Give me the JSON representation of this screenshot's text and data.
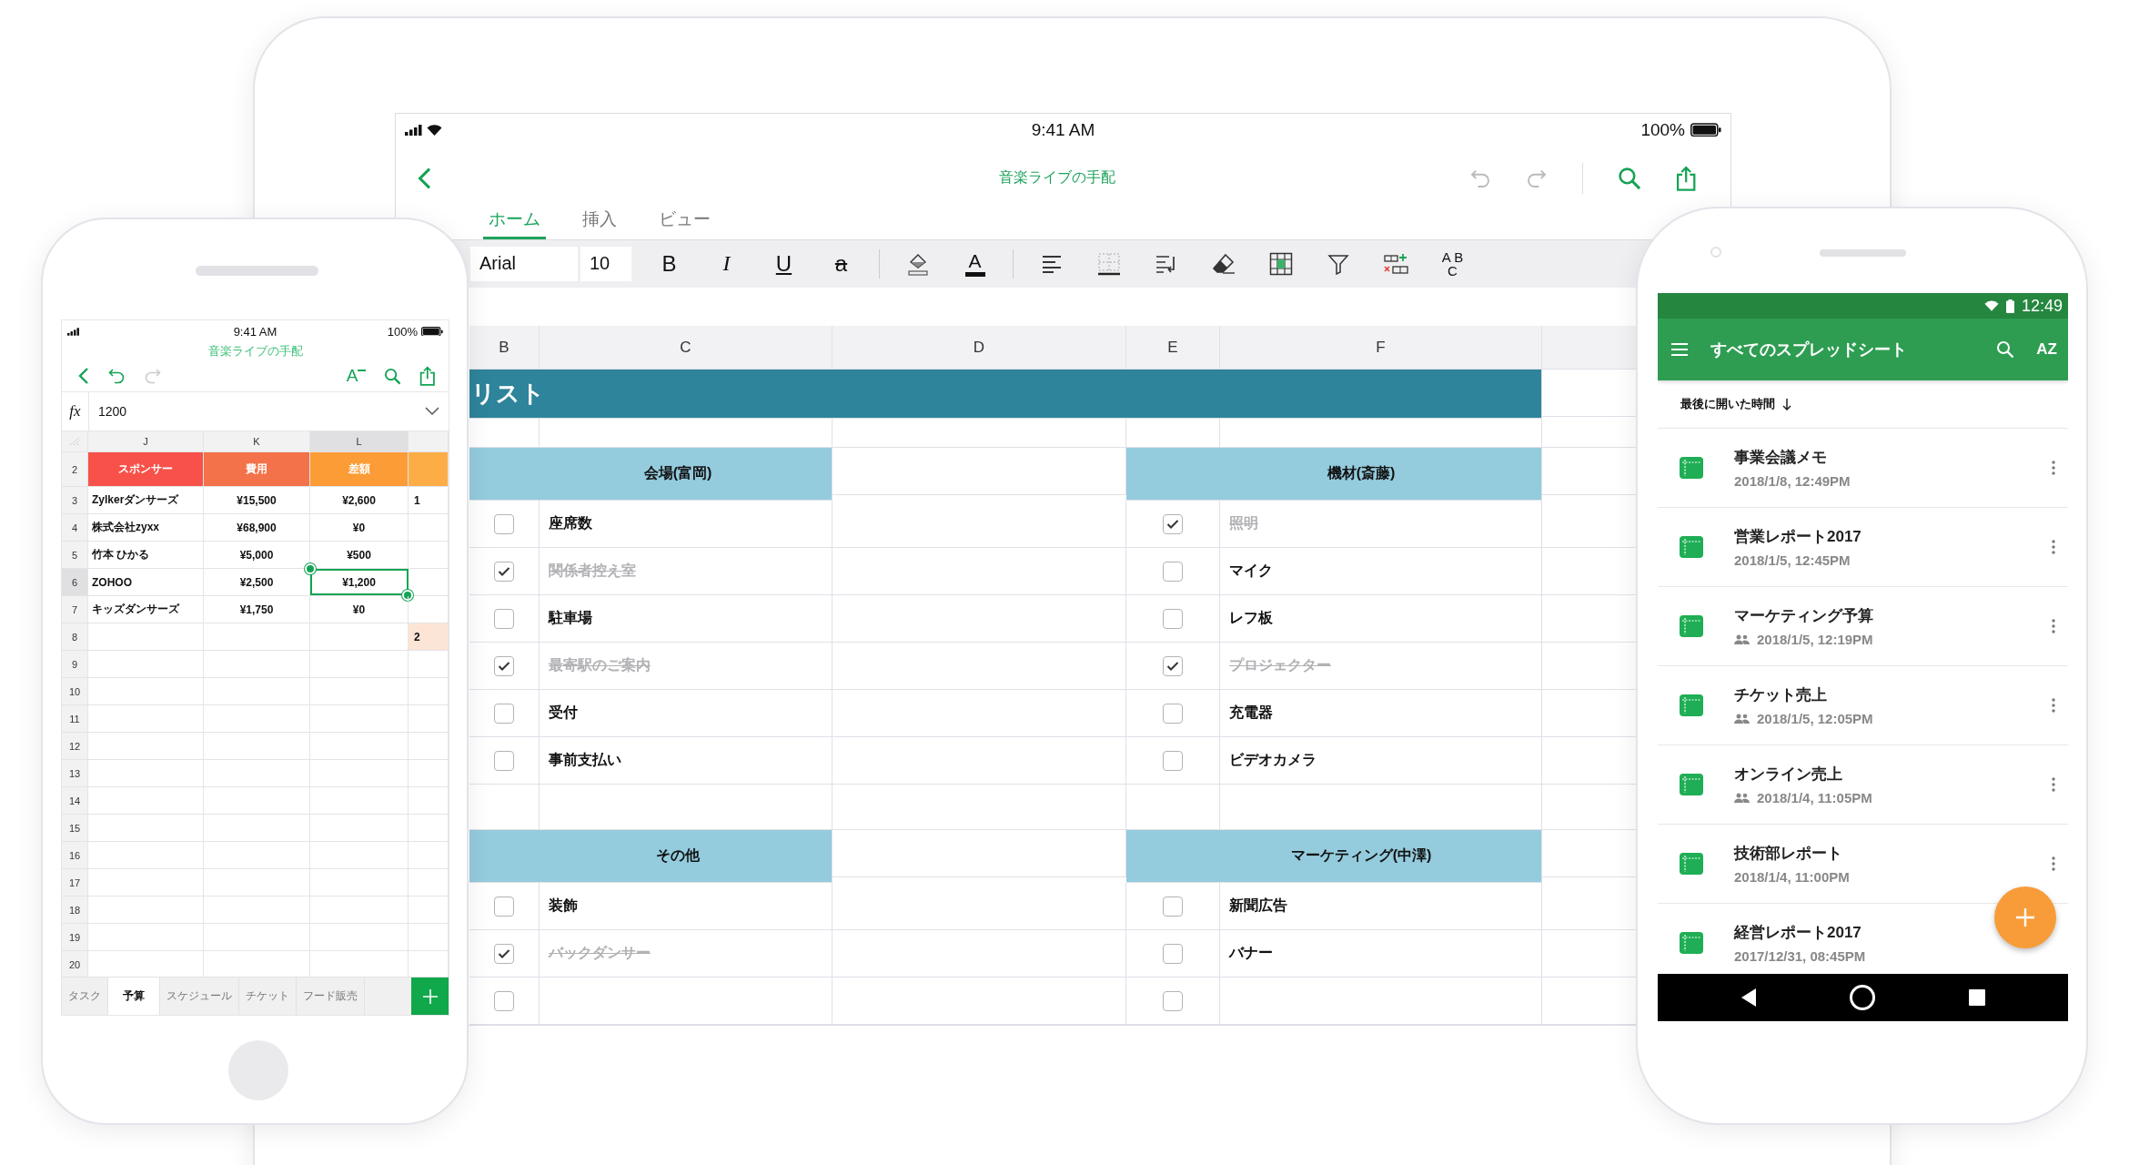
{
  "tablet": {
    "status_bar": {
      "time": "9:41 AM",
      "battery": "100%"
    },
    "title": "音楽ライブの手配",
    "tabs": [
      {
        "label": "ホーム",
        "selected": true
      },
      {
        "label": "挿入",
        "selected": false
      },
      {
        "label": "ビュー",
        "selected": false
      }
    ],
    "toolbar": {
      "font": "Arial",
      "size": "10",
      "bold": "B",
      "italic": "I",
      "underline": "U",
      "strikethrough": "a",
      "font_color": "A",
      "spelling": [
        "A B",
        "C"
      ]
    },
    "sheet": {
      "columns": [
        "B",
        "C",
        "D",
        "E",
        "F"
      ],
      "title": "リスト",
      "blocks": [
        {
          "left_header": "会場(富岡)",
          "right_header": "機材(斎藤)",
          "rows": [
            {
              "left": {
                "label": "座席数",
                "checked": false
              },
              "right": {
                "label": "照明",
                "checked": true
              }
            },
            {
              "left": {
                "label": "関係者控え室",
                "checked": true
              },
              "right": {
                "label": "マイク",
                "checked": false
              }
            },
            {
              "left": {
                "label": "駐車場",
                "checked": false
              },
              "right": {
                "label": "レフ板",
                "checked": false
              }
            },
            {
              "left": {
                "label": "最寄駅のご案内",
                "checked": true
              },
              "right": {
                "label": "プロジェクター",
                "checked": true
              }
            },
            {
              "left": {
                "label": "受付",
                "checked": false
              },
              "right": {
                "label": "充電器",
                "checked": false
              }
            },
            {
              "left": {
                "label": "事前支払い",
                "checked": false
              },
              "right": {
                "label": "ビデオカメラ",
                "checked": false
              }
            }
          ]
        },
        {
          "left_header": "その他",
          "right_header": "マーケティング(中澤)",
          "rows": [
            {
              "left": {
                "label": "装飾",
                "checked": false
              },
              "right": {
                "label": "新聞広告",
                "checked": false
              }
            },
            {
              "left": {
                "label": "バックダンサー",
                "checked": true
              },
              "right": {
                "label": "バナー",
                "checked": false
              }
            },
            {
              "left": {
                "checked": false
              },
              "right": {
                "checked": false
              }
            }
          ]
        }
      ]
    }
  },
  "phone_sheet": {
    "status_bar": {
      "time": "9:41 AM",
      "battery": "100%"
    },
    "title": "音楽ライブの手配",
    "format_button": "A",
    "formula_label": "fx",
    "formula": "1200",
    "columns": [
      {
        "label": "J",
        "selected": false
      },
      {
        "label": "K",
        "selected": false
      },
      {
        "label": "L",
        "selected": true
      }
    ],
    "header_row": {
      "num": "2",
      "cells": [
        {
          "text": "スポンサー",
          "color": "#f8514a"
        },
        {
          "text": "費用",
          "color": "#f4724a"
        },
        {
          "text": "差額",
          "color": "#fb9c37"
        },
        {
          "color": "#fcad46"
        }
      ]
    },
    "rows": [
      {
        "num": "3",
        "selected": false,
        "cells": [
          "Zylkerダンサーズ",
          "¥15,500",
          "¥2,600"
        ],
        "column_5": {
          "text": "1",
          "highlighted": false
        }
      },
      {
        "num": "4",
        "selected": false,
        "cells": [
          "株式会社zyxx",
          "¥68,900",
          "¥0"
        ]
      },
      {
        "num": "5",
        "selected": false,
        "cells": [
          "竹本 ひかる",
          "¥5,000",
          "¥500"
        ]
      },
      {
        "num": "6",
        "selected": true,
        "cells": [
          "ZOHOO",
          "¥2,500",
          "¥1,200"
        ]
      },
      {
        "num": "7",
        "selected": false,
        "cells": [
          "キッズダンサーズ",
          "¥1,750",
          "¥0"
        ]
      },
      {
        "num": "8",
        "selected": false,
        "cells": [],
        "column_5": {
          "text": "2",
          "highlighted": true
        }
      },
      {
        "num": "9",
        "selected": false,
        "cells": []
      },
      {
        "num": "10",
        "selected": false,
        "cells": []
      },
      {
        "num": "11",
        "selected": false,
        "cells": []
      },
      {
        "num": "12",
        "selected": false,
        "cells": []
      },
      {
        "num": "13",
        "selected": false,
        "cells": []
      },
      {
        "num": "14",
        "selected": false,
        "cells": []
      },
      {
        "num": "15",
        "selected": false,
        "cells": []
      },
      {
        "num": "16",
        "selected": false,
        "cells": []
      },
      {
        "num": "17",
        "selected": false,
        "cells": []
      },
      {
        "num": "18",
        "selected": false,
        "cells": []
      },
      {
        "num": "19",
        "selected": false,
        "cells": []
      },
      {
        "num": "20",
        "selected": false,
        "cells": []
      }
    ],
    "sheet_tabs": [
      {
        "label": "タスク",
        "selected": false
      },
      {
        "label": "予算",
        "selected": true
      },
      {
        "label": "スケジュール",
        "selected": false
      },
      {
        "label": "チケット",
        "selected": false
      },
      {
        "label": "フード販売",
        "selected": false
      }
    ]
  },
  "android": {
    "time": "12:49",
    "title": "すべてのスプレッドシート",
    "sort_button": "AZ",
    "sort_label": "最後に開いた時間",
    "files": [
      {
        "name": "事業会議メモ",
        "date": "2018/1/8, 12:49PM",
        "shared": false
      },
      {
        "name": "営業レポート2017",
        "date": "2018/1/5, 12:45PM",
        "shared": false
      },
      {
        "name": "マーケティング予算",
        "date": "2018/1/5, 12:19PM",
        "shared": true
      },
      {
        "name": "チケット売上",
        "date": "2018/1/5, 12:05PM",
        "shared": true
      },
      {
        "name": "オンライン売上",
        "date": "2018/1/4, 11:05PM",
        "shared": true
      },
      {
        "name": "技術部レポート",
        "date": "2018/1/4, 11:00PM",
        "shared": false
      },
      {
        "name": "経営レポート2017",
        "date": "2017/12/31, 08:45PM",
        "shared": false
      }
    ]
  }
}
